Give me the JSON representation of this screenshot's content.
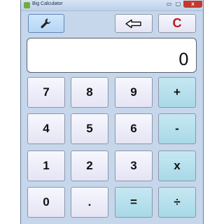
{
  "window": {
    "title": "Big Calculator"
  },
  "controls": {
    "minimize": "▭",
    "maximize": "▢",
    "close": "x"
  },
  "display": {
    "value": "0"
  },
  "buttons": {
    "clear": "C",
    "row1": [
      "7",
      "8",
      "9",
      "+"
    ],
    "row2": [
      "4",
      "5",
      "6",
      "-"
    ],
    "row3": [
      "1",
      "2",
      "3",
      "x"
    ],
    "row4": [
      "0",
      ".",
      "=",
      "÷"
    ]
  },
  "icons": {
    "settings": "wrench-icon",
    "backspace": "left-arrow-icon"
  },
  "colors": {
    "window_bg": "#c6d7ec",
    "key_bg": "#eeeefc",
    "operator_bg": "#b7dfec",
    "clear_text": "#b51d1d"
  }
}
